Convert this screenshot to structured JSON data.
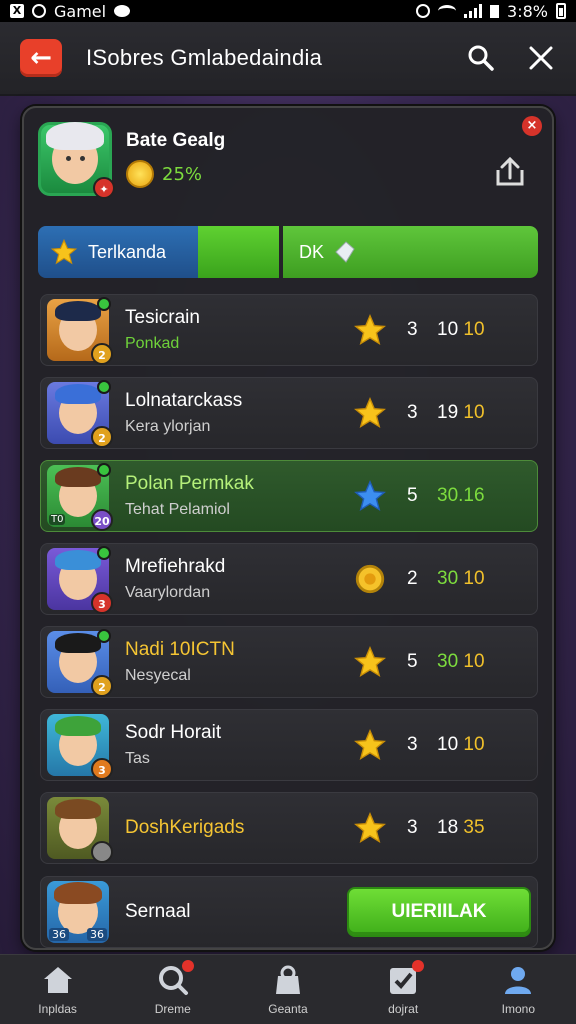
{
  "status_bar": {
    "app": "Gamel",
    "right": "3:8%"
  },
  "header": {
    "title": "ISobres Gmlabedaindia"
  },
  "profile": {
    "name": "Bate Gealg",
    "percent": "25%"
  },
  "progress": {
    "label": "Terlkanda",
    "fill_fraction": 0.6,
    "right_label": "DK"
  },
  "rows": [
    {
      "name": "Tesicrain",
      "sub": "Ponkad",
      "rank": "3",
      "score_a": "10",
      "score_b": "10",
      "sub_color": "green",
      "name_color": "white",
      "icon": "star-icon",
      "badge": "2"
    },
    {
      "name": "Lolnatarckass",
      "sub": "Kera ylorjan",
      "rank": "3",
      "score_a": "19",
      "score_b": "10",
      "sub_color": "white",
      "name_color": "white",
      "icon": "star-icon",
      "badge": "2"
    },
    {
      "name": "Polan Permkak",
      "sub": "Tehat Pelamiol",
      "rank": "5",
      "score_a": "30.16",
      "score_b": "",
      "sub_color": "white",
      "name_color": "green",
      "icon": "blue-star-icon",
      "badge": "20",
      "badge_left": "T0",
      "highlight": true
    },
    {
      "name": "Mrefiehrakd",
      "sub": "Vaarylordan",
      "rank": "2",
      "score_a": "30",
      "score_b": "10",
      "sub_color": "white",
      "name_color": "white",
      "icon": "coin-icon",
      "badge": "3"
    },
    {
      "name": "Nadi 10ICTN",
      "sub": "Nesyecal",
      "rank": "5",
      "score_a": "30",
      "score_b": "10",
      "sub_color": "white",
      "name_color": "yellow",
      "icon": "star-icon",
      "badge": "2"
    },
    {
      "name": "Sodr Horait",
      "sub": "Tas",
      "rank": "3",
      "score_a": "10",
      "score_b": "10",
      "sub_color": "white",
      "name_color": "white",
      "icon": "star-icon",
      "badge": "3"
    },
    {
      "name": "DoshKerigads",
      "sub": "",
      "rank": "3",
      "score_a": "18",
      "score_b": "35",
      "sub_color": "white",
      "name_color": "yellow",
      "icon": "star-icon",
      "badge": ""
    }
  ],
  "bottom": {
    "name": "Sernaal",
    "badge_left": "36",
    "badge_right": "36",
    "button": "UIERIILAK"
  },
  "nav": [
    {
      "label": "Inpldas",
      "icon": "home-icon"
    },
    {
      "label": "Dreme",
      "icon": "search-icon"
    },
    {
      "label": "Geanta",
      "icon": "bag-icon"
    },
    {
      "label": "dojrat",
      "icon": "check-icon"
    },
    {
      "label": "Imono",
      "icon": "profile-icon"
    }
  ]
}
